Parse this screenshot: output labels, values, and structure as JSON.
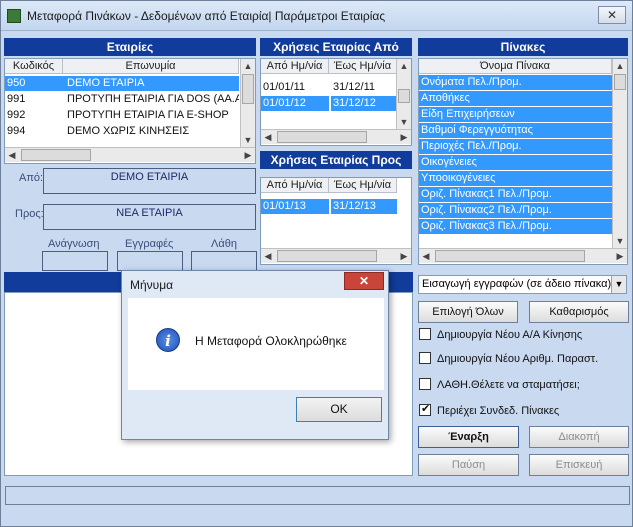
{
  "window": {
    "title": "Μεταφορά Πινάκων - Δεδομένων από Εταιρία| Παράμετροι Εταιρίας",
    "close_glyph": "✕"
  },
  "companies": {
    "header": "Εταιρίες",
    "columns": [
      "Κωδικός",
      "Επωνυμία"
    ],
    "rows": [
      {
        "code": "950",
        "name": "DEMO ΕΤΑΙΡΙΑ"
      },
      {
        "code": "991",
        "name": "ΠΡΟΤΥΠΗ ΕΤΑΙΡΙΑ ΓΙΑ DOS (ΑΑ.ΑΑ"
      },
      {
        "code": "992",
        "name": "ΠΡΟΤΥΠΗ ΕΤΑΙΡΙΑ ΓΙΑ E-SHOP"
      },
      {
        "code": "994",
        "name": "DEMO ΧΩΡΙΣ ΚΙΝΗΣΕΙΣ"
      }
    ]
  },
  "uses_from": {
    "header": "Χρήσεις Εταιρίας Από",
    "columns": [
      "Από Ημ/νία",
      "Έως Ημ/νία"
    ],
    "rows": [
      {
        "from": "01/01/11",
        "to": "31/12/11"
      },
      {
        "from": "01/01/12",
        "to": "31/12/12"
      }
    ]
  },
  "uses_to": {
    "header": "Χρήσεις Εταιρίας Προς",
    "columns": [
      "Από Ημ/νία",
      "Έως Ημ/νία"
    ],
    "rows": [
      {
        "from": "01/01/13",
        "to": "31/12/13"
      }
    ]
  },
  "tables": {
    "header": "Πίνακες",
    "column": "Όνομα Πίνακα",
    "rows": [
      "Ονόματα Πελ./Προμ.",
      "Αποθήκες",
      "Είδη Επιχειρήσεων",
      "Βαθμοί Φερεγγυότητας",
      "Περιοχές Πελ./Προμ.",
      "Οικογένειες",
      "Υποοικογένειες",
      "Οριζ. Πίνακας1 Πελ./Προμ.",
      "Οριζ. Πίνακας2 Πελ./Προμ.",
      "Οριζ. Πίνακας3 Πελ./Προμ."
    ]
  },
  "transfer": {
    "from_label": "Από:",
    "from_value": "DEMO ΕΤΑΙΡΙΑ",
    "to_label": "Προς:",
    "to_value": "ΝΕΑ ΕΤΑΙΡΙΑ",
    "read_label": "Ανάγνωση",
    "written_label": "Εγγραφές",
    "errors_label": "Λάθη"
  },
  "options": {
    "mode_select": "Εισαγωγή εγγραφών (σε άδειο πίνακα)",
    "select_all": "Επιλογή Όλων",
    "clear": "Καθαρισμός",
    "chk_new_aa": "Δημιουργία Νέου Α/Α Κίνησης",
    "chk_new_doc": "Δημιουργία Νέου Αριθμ. Παραστ.",
    "chk_stop_error": "ΛΑΘΗ.Θέλετε να σταματήσει;",
    "chk_linked": "Περιέχει Συνδεδ. Πίνακες",
    "start": "Έναρξη",
    "stop": "Διακοπή",
    "pause": "Παύση",
    "resume": "Επισκευή"
  },
  "dialog": {
    "title": "Μήνυμα",
    "message": "Η Μεταφορά Ολοκληρώθηκε",
    "ok": "OK",
    "close_glyph": "✕",
    "icon_glyph": "i"
  },
  "arrows": {
    "up": "▲",
    "down": "▼",
    "left": "◀",
    "right": "▶"
  }
}
